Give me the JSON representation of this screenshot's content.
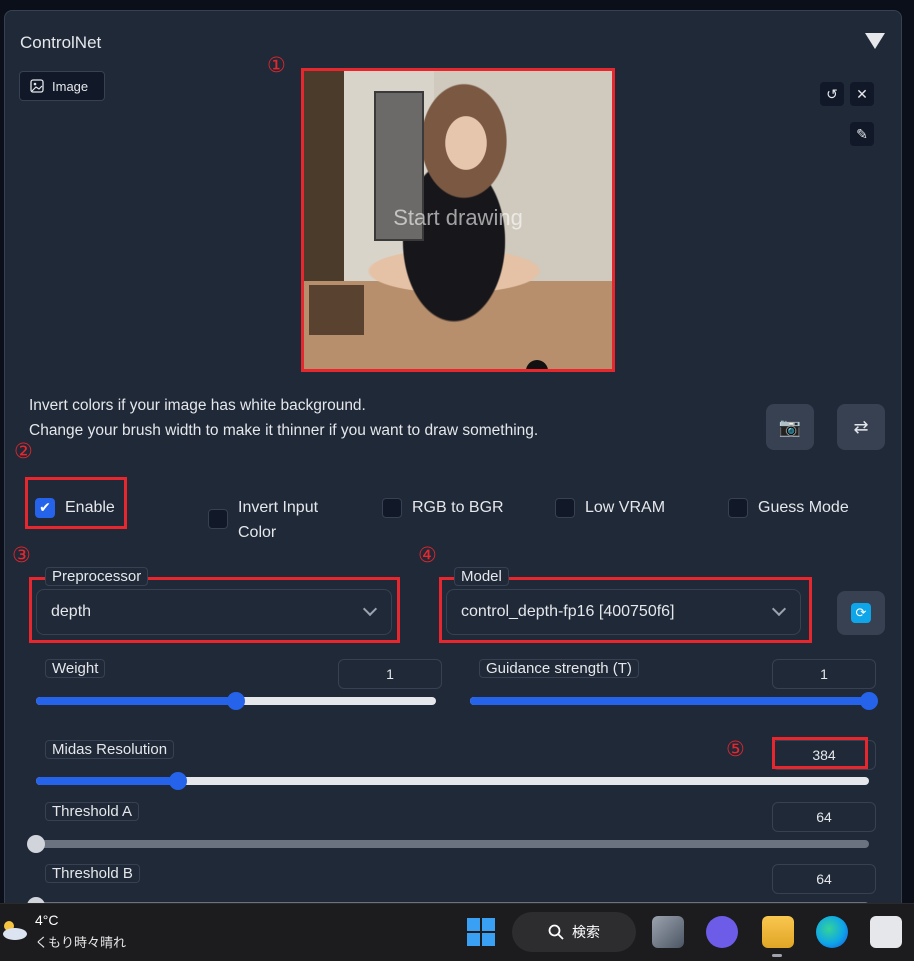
{
  "panel": {
    "title": "ControlNet",
    "image_tab": "Image"
  },
  "canvas": {
    "placeholder": "Start drawing"
  },
  "badges": [
    "①",
    "②",
    "③",
    "④",
    "⑤"
  ],
  "info": {
    "line1": "Invert colors if your image has white background.",
    "line2": "Change your brush width to make it thinner if you want to draw something."
  },
  "checkboxes": {
    "enable": {
      "label": "Enable",
      "checked": true
    },
    "invert_line1": "Invert Input",
    "invert_line2": "Color",
    "rgb_to_bgr": "RGB to BGR",
    "low_vram": "Low VRAM",
    "guess_mode": "Guess Mode"
  },
  "preprocessor": {
    "label": "Preprocessor",
    "value": "depth"
  },
  "model": {
    "label": "Model",
    "value": "control_depth-fp16 [400750f6]"
  },
  "sliders": {
    "weight": {
      "label": "Weight",
      "value": "1",
      "fraction": 0.5
    },
    "guidance": {
      "label": "Guidance strength (T)",
      "value": "1",
      "fraction": 1.0
    },
    "midas": {
      "label": "Midas Resolution",
      "value": "384",
      "fraction": 0.17
    },
    "threshold_a": {
      "label": "Threshold A",
      "value": "64",
      "fraction": 0.0
    },
    "threshold_b": {
      "label": "Threshold B",
      "value": "64",
      "fraction": 0.0
    }
  },
  "taskbar": {
    "temperature": "4°C",
    "condition": "くもり時々晴れ",
    "search_label": "検索"
  },
  "colors": {
    "accent": "#2563eb",
    "annotation": "#e8262d",
    "panel": "#1f2937"
  }
}
